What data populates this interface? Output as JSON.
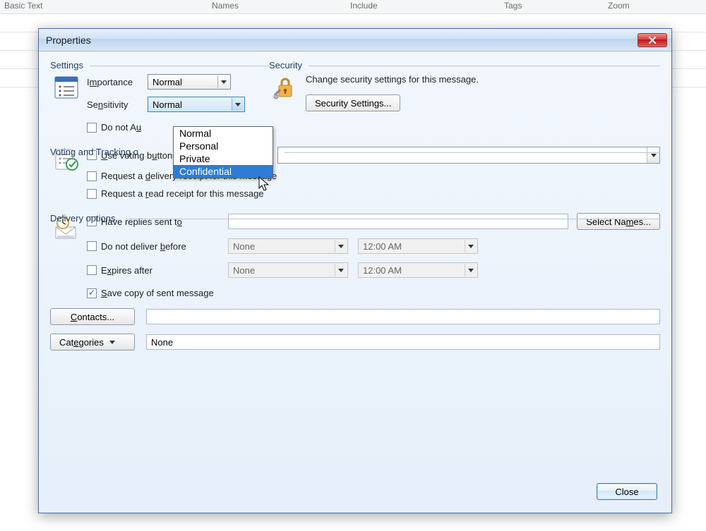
{
  "ribbon": {
    "basic_text": "Basic Text",
    "names": "Names",
    "include": "Include",
    "tags": "Tags",
    "zoom": "Zoom"
  },
  "dialog": {
    "title": "Properties",
    "settings": {
      "label": "Settings",
      "importance_label": "Importance",
      "importance_value": "Normal",
      "sensitivity_label": "Sensitivity",
      "sensitivity_value": "Normal",
      "sensitivity_options": [
        "Normal",
        "Personal",
        "Private",
        "Confidential"
      ],
      "sensitivity_highlighted": "Confidential",
      "autoarchive_label": "Do not Au",
      "autoarchive_checked": false
    },
    "security": {
      "label": "Security",
      "description": "Change security settings for this message.",
      "button": "Security Settings..."
    },
    "voting": {
      "label": "Voting and Tracking o",
      "use_voting_label": "Use voting buttons",
      "use_voting_checked": false,
      "delivery_receipt_label": "Request a delivery receipt for this message",
      "delivery_receipt_checked": false,
      "read_receipt_label": "Request a read receipt for this message",
      "read_receipt_checked": false
    },
    "delivery": {
      "label": "Delivery options",
      "replies_label": "Have replies sent to",
      "replies_checked": false,
      "replies_value": "",
      "select_names_button": "Select Names...",
      "not_before_label": "Do not deliver before",
      "not_before_checked": false,
      "not_before_date": "None",
      "not_before_time": "12:00 AM",
      "expires_label": "Expires after",
      "expires_checked": false,
      "expires_date": "None",
      "expires_time": "12:00 AM",
      "save_copy_label": "Save copy of sent message",
      "save_copy_checked": true,
      "contacts_button": "Contacts...",
      "contacts_value": "",
      "categories_button": "Categories",
      "categories_value": "None"
    },
    "close_button": "Close"
  }
}
